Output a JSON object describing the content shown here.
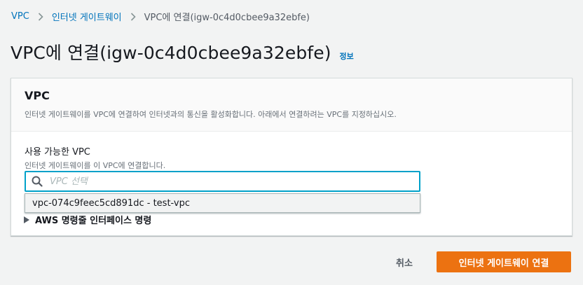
{
  "breadcrumb": {
    "items": [
      "VPC",
      "인터넷 게이트웨이",
      "VPC에 연결(igw-0c4d0cbee9a32ebfe)"
    ]
  },
  "page": {
    "title": "VPC에 연결(igw-0c4d0cbee9a32ebfe)",
    "info_link": "정보"
  },
  "panel": {
    "title": "VPC",
    "description": "인터넷 게이트웨이를 VPC에 연결하여 인터넷과의 통신을 활성화합니다. 아래에서 연결하려는 VPC를 지정하십시오."
  },
  "field": {
    "label": "사용 가능한 VPC",
    "description": "인터넷 게이트웨이를 이 VPC에 연결합니다.",
    "placeholder": "VPC 선택",
    "value": ""
  },
  "dropdown": {
    "options": [
      "vpc-074c9feec5cd891dc - test-vpc"
    ]
  },
  "cli_section": {
    "label": "AWS 명령줄 인터페이스 명령"
  },
  "actions": {
    "cancel": "취소",
    "submit": "인터넷 게이트웨이 연결"
  },
  "icons": {
    "breadcrumb_separator": "chevron-right-icon",
    "search": "search-icon",
    "expand": "caret-right-icon"
  },
  "colors": {
    "link": "#0073bb",
    "primary_button": "#ec7211",
    "focus_border": "#00a1c9",
    "background": "#f2f3f3"
  }
}
